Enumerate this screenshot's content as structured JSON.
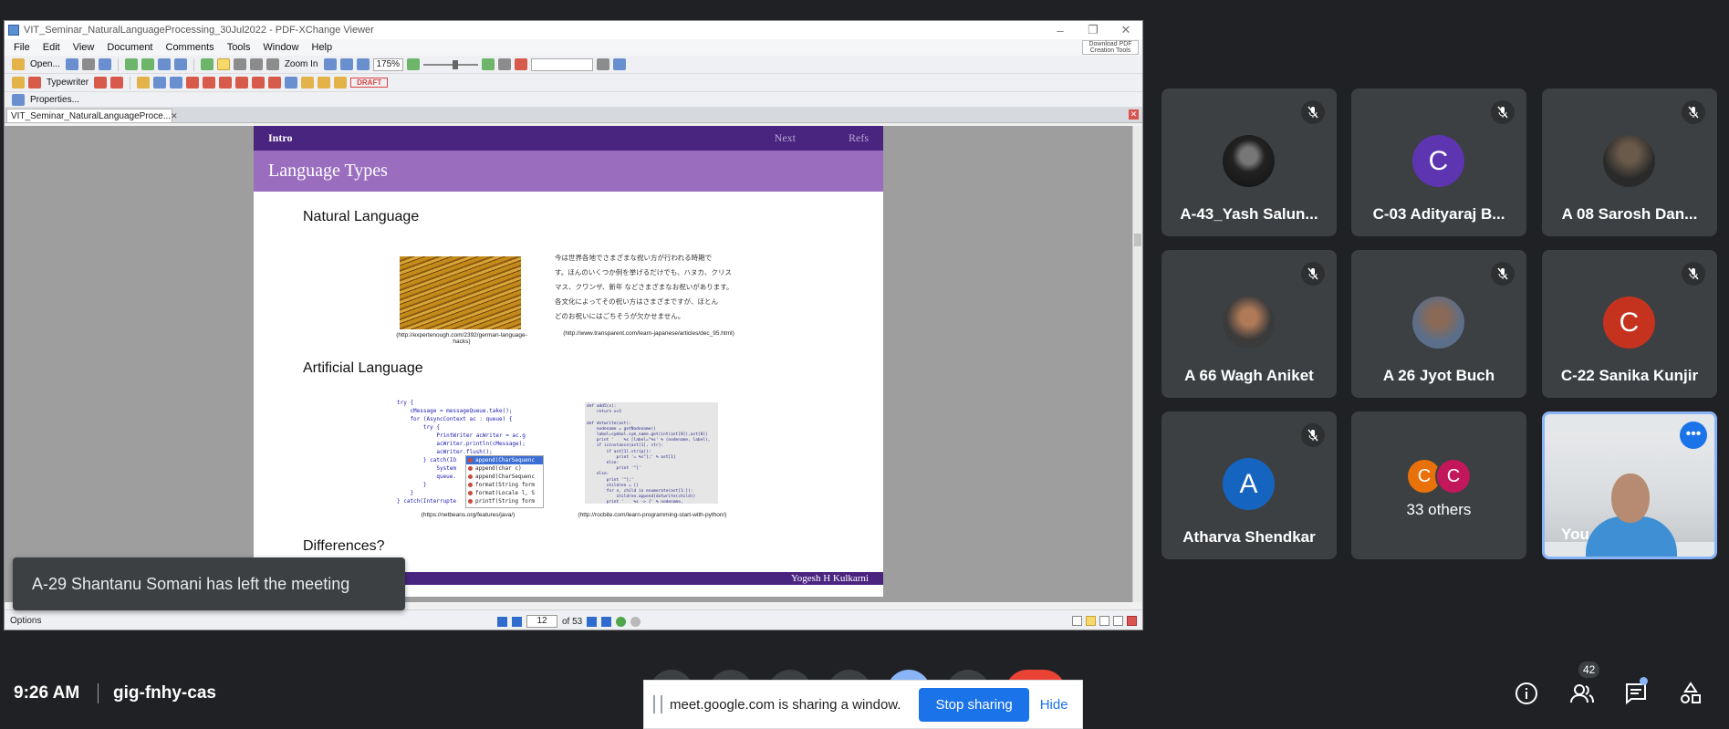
{
  "pdf_window": {
    "title": "VIT_Seminar_NaturalLanguageProcessing_30Jul2022 - PDF-XChange Viewer",
    "menu": [
      "File",
      "Edit",
      "View",
      "Document",
      "Comments",
      "Tools",
      "Window",
      "Help"
    ],
    "promo_label": "Download PDF Creation Tools",
    "toolbar": {
      "open_label": "Open...",
      "zoom_in_label": "Zoom In",
      "zoom_value": "175%",
      "typewriter_label": "Typewriter",
      "draft_label": "DRAFT",
      "properties_label": "Properties..."
    },
    "tab_label": "VIT_Seminar_NaturalLanguageProce...",
    "status": {
      "options_label": "Options",
      "page_current": "12",
      "page_total": "of 53"
    }
  },
  "slide": {
    "nav_intro": "Intro",
    "nav_next": "Next",
    "nav_refs": "Refs",
    "heading": "Language Types",
    "section_natural": "Natural Language",
    "caption_photo": "(http://expertenough.com/2392/german-language-hacks)",
    "jp_lines": [
      "今は世界各地でさまざまな祝い方が行われる時期で",
      "す。ほんのいくつか例を挙げるだけでも、ハヌカ、クリス",
      "マス、クワンザ、新年 などさまざまなお祝いがあります。",
      "各文化によってその祝い方はさまざまですが、ほとん",
      "どのお祝いにはごちそうが欠かせません。"
    ],
    "caption_jp": "(http://www.transparent.com/learn-japanese/articles/dec_95.html)",
    "section_artificial": "Artificial Language",
    "java_code": "try {\n    cMessage = messageQueue.take();\n    for (AsyncContext ac : queue) {\n        try {\n            PrintWriter acWriter = ac.g\n            acWriter.println(cMessage);\n            acWriter.flush();\n        } catch(IO\n            System\n            queue.\n        }\n    }\n} catch(Interrupte",
    "autocomplete": [
      "append(CharSequenc",
      "append(char c)",
      "append(CharSequenc",
      "format(String form",
      "format(Locale l, S",
      "printf(String form"
    ],
    "caption_java": "(https://netbeans.org/features/java/)",
    "python_code": "def add5(x):\n    return x+5\n\ndef dotwrite(ast):\n    nodename = getNodename()\n    label=symbol.sym_name.get(int(ast[0]),ast[0])\n    print '    %s [label=\"%s' % (nodename, label),\n    if isinstance(ast[1], str):\n        if ast[1].strip():\n            print '= %s\"];' % ast[1]\n        else:\n            print '\"]'\n    else:\n        print '\"];'\n        children = []\n        for n, child in enumerate(ast[1:]):\n            children.append(dotwrite(child))\n        print '    %s -> {' % nodename,\n        for name in children:\n            print '%s' % name,",
    "caption_python": "(http://rocbite.com/learn-programming-start-with-python/)",
    "section_differences": "Differences?",
    "footer_author": "Yogesh H Kulkarni"
  },
  "toast": {
    "text": "A-29 Shantanu Somani has left the meeting"
  },
  "participants": [
    {
      "name": "A-43_Yash Salun...",
      "initial": "",
      "avatar_color": "#111111",
      "muted": true
    },
    {
      "name": "C-03 Adityaraj B...",
      "initial": "C",
      "avatar_color": "#5e35b1",
      "muted": true
    },
    {
      "name": "A 08 Sarosh Dan...",
      "initial": "",
      "avatar_color": "#3a3a3a",
      "muted": true
    },
    {
      "name": "A 66 Wagh Aniket",
      "initial": "",
      "avatar_color": "#444444",
      "muted": true
    },
    {
      "name": "A 26 Jyot Buch",
      "initial": "",
      "avatar_color": "#5b6e8a",
      "muted": true
    },
    {
      "name": "C-22 Sanika Kunjir",
      "initial": "C",
      "avatar_color": "#c5331f",
      "muted": true
    },
    {
      "name": "Atharva Shendkar",
      "initial": "A",
      "avatar_color": "#1565c0",
      "muted": true
    },
    {
      "name": "33 others",
      "initial_1": "C",
      "initial_2": "C",
      "color_1": "#e8710a",
      "color_2": "#c2185b"
    },
    {
      "name": "You"
    }
  ],
  "meeting": {
    "time": "9:26 AM",
    "code": "gig-fnhy-cas",
    "participant_count": "42"
  },
  "sharing_bar": {
    "text": "meet.google.com is sharing a window.",
    "stop_label": "Stop sharing",
    "hide_label": "Hide"
  },
  "colors": {
    "slide_purple_dark": "#4a2580",
    "slide_purple_light": "#9a6dbf",
    "meet_blue": "#1a73e8",
    "meet_tile": "#3c4043",
    "meet_bg": "#202124"
  }
}
